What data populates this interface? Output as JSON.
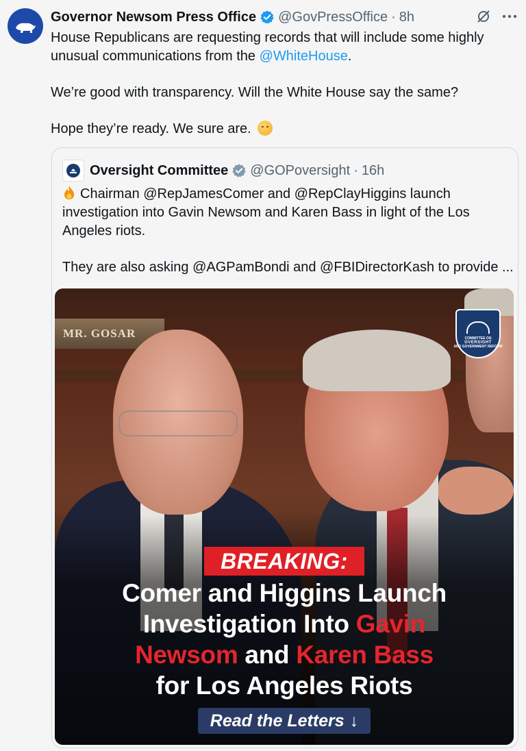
{
  "tweet": {
    "display_name": "Governor Newsom Press Office",
    "handle": "@GovPressOffice",
    "separator": "·",
    "time": "8h",
    "text_line1a": "House Republicans are requesting records that will include some highly unusual communications from the ",
    "text_mention": "@WhiteHouse",
    "text_line1b": ".",
    "text_line2": "We’re good with transparency. Will the White House say the same?",
    "text_line3": "Hope they’re ready. We sure are."
  },
  "quoted": {
    "display_name": "Oversight Committee",
    "handle": "@GOPoversight",
    "separator": "·",
    "time": "16h",
    "text_line1": "Chairman @RepJamesComer and @RepClayHiggins launch investigation into Gavin Newsom and Karen Bass in light of the Los Angeles riots.",
    "text_line2": "They are also asking @AGPamBondi and @FBIDirectorKash to provide ..."
  },
  "media": {
    "nameplate": "MR. GOSAR",
    "badge_line1": "COMMITTEE ON",
    "badge_line2": "OVERSIGHT",
    "badge_line3": "AND GOVERNMENT REFORM",
    "breaking": "BREAKING:",
    "headline_a": "Comer and Higgins Launch",
    "headline_b": "Investigation Into ",
    "headline_red1": "Gavin",
    "headline_red2": "Newsom",
    "headline_c": " and ",
    "headline_red3": "Karen Bass",
    "headline_d": "for Los Angeles Riots",
    "button_label": "Read the Letters",
    "button_arrow": "↓"
  },
  "icons": {
    "avatar": "california-bear-icon",
    "verified": "verified-badge-icon",
    "grok": "grok-icon",
    "more": "more-icon",
    "fire": "fire-emoji",
    "emoji": "face-with-hand-over-mouth-emoji"
  },
  "colors": {
    "link": "#1d9bf0",
    "verified": "#1d9bf0",
    "breaking_red": "#e02027",
    "button_blue": "#2a3b66"
  }
}
